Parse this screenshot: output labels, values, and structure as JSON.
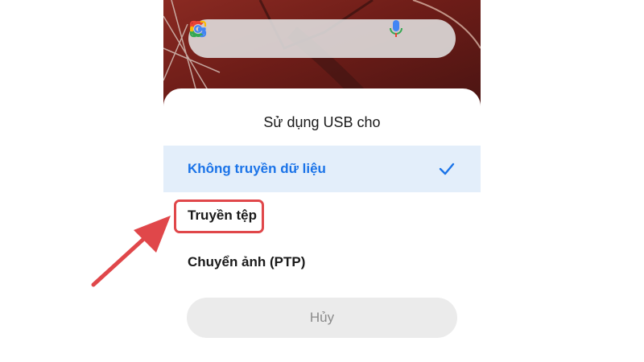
{
  "sheet": {
    "title": "Sử dụng USB cho",
    "options": [
      {
        "label": "Không truyền dữ liệu",
        "selected": true
      },
      {
        "label": "Truyền tệp",
        "selected": false
      },
      {
        "label": "Chuyển ảnh (PTP)",
        "selected": false
      }
    ],
    "cancel_label": "Hủy"
  },
  "icons": {
    "search_logo": "google-g-icon",
    "voice": "mic-icon",
    "camera": "google-lens-icon",
    "selected_marker": "check-icon"
  },
  "colors": {
    "accent": "#1a73e8",
    "selected_bg": "#e3eefa",
    "annotation": "#e0474a"
  }
}
